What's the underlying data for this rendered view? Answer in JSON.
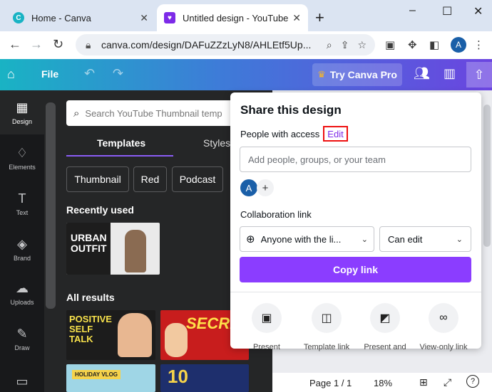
{
  "browser": {
    "tabs": [
      {
        "title": "Home - Canva",
        "active": false
      },
      {
        "title": "Untitled design - YouTube Th",
        "active": true
      }
    ],
    "new_tab": "+",
    "window_controls": [
      "–",
      "☐",
      "✕"
    ],
    "url": "canva.com/design/DAFuZZzLyN8/AHLEtf5Up...",
    "profile_initial": "A"
  },
  "canva_header": {
    "file_label": "File",
    "try_pro_label": "Try Canva Pro"
  },
  "rail": {
    "items": [
      {
        "label": "Design",
        "icon": "layout-icon"
      },
      {
        "label": "Elements",
        "icon": "shapes-icon"
      },
      {
        "label": "Text",
        "icon": "text-icon"
      },
      {
        "label": "Brand",
        "icon": "brand-icon"
      },
      {
        "label": "Uploads",
        "icon": "upload-cloud-icon"
      },
      {
        "label": "Draw",
        "icon": "pen-icon"
      },
      {
        "label": "",
        "icon": "folder-icon"
      }
    ]
  },
  "panel": {
    "search_placeholder": "Search YouTube Thumbnail temp",
    "tabs": [
      "Templates",
      "Styles"
    ],
    "chips": [
      "Thumbnail",
      "Red",
      "Podcast"
    ],
    "recently_used": "Recently used",
    "all_results": "All results",
    "thumbs": {
      "urban_outfit": "URBAN OUTFIT",
      "positive": "POSITIVE SELF TALK",
      "secret": "SECRET",
      "holiday": "HOLIDAY VLOG"
    }
  },
  "share": {
    "title": "Share this design",
    "people_access": "People with access",
    "edit_label": "Edit",
    "add_placeholder": "Add people, groups, or your team",
    "avatar_initial": "A",
    "collab_label": "Collaboration link",
    "access_value": "Anyone with the li...",
    "permission_value": "Can edit",
    "copy_label": "Copy link",
    "options": [
      {
        "label": "Present",
        "icon": "present-icon"
      },
      {
        "label": "Template link",
        "icon": "template-icon"
      },
      {
        "label": "Present and",
        "icon": "camera-icon"
      },
      {
        "label": "View-only link",
        "icon": "link-icon"
      }
    ]
  },
  "bottom": {
    "page": "Page 1 / 1",
    "zoom": "18%",
    "help": "?"
  }
}
